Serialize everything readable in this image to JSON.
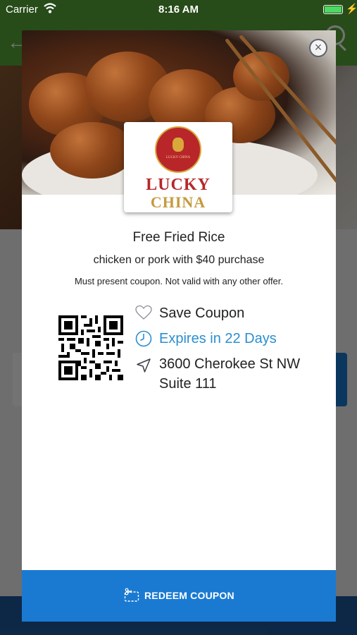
{
  "status_bar": {
    "carrier": "Carrier",
    "time": "8:16 AM",
    "wifi_icon": "wifi-icon",
    "battery_icon": "battery-icon"
  },
  "coupon": {
    "hero_image": "orange-chicken-photo",
    "close_icon": "close-icon",
    "logo": {
      "emblem_text": "LUCKY CHINA",
      "line1": "LUCKY",
      "line2": "CHINA",
      "brand_color": "#b8262a",
      "accent_color": "#c59a3d"
    },
    "title": "Free Fried Rice",
    "subtitle": "chicken or pork with $40 purchase",
    "terms": "Must present coupon. Not valid with any other offer.",
    "details": {
      "save_label": "Save Coupon",
      "save_icon": "heart-icon",
      "expires_label": "Expires in 22 Days",
      "expires_icon": "clock-icon",
      "expires_color": "#2a8fd0",
      "address_line1": "3600 Cherokee St NW",
      "address_line2": "Suite 111",
      "address_icon": "location-arrow-icon"
    },
    "redeem": {
      "label": "REDEEM COUPON",
      "icon": "scissors-coupon-icon",
      "color": "#1a7ad1"
    }
  }
}
